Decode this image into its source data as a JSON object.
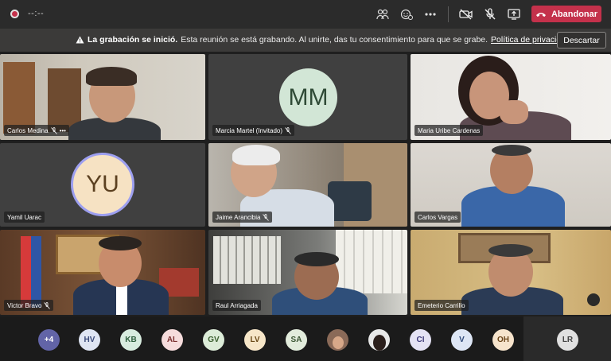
{
  "topbar": {
    "timer": "--:--",
    "leave_label": "Abandonar",
    "icons": [
      "people-icon",
      "react-icon",
      "more-icon",
      "camera-off-icon",
      "mic-off-icon",
      "share-screen-icon",
      "phone-hangup-icon"
    ]
  },
  "banner": {
    "title": "La grabación se inició.",
    "message": "Esta reunión se está grabando. Al unirte, das tu consentimiento para que se grabe.",
    "link": "Política de privacidad",
    "dismiss_label": "Descartar"
  },
  "participants": [
    {
      "name": "Carlos Medina",
      "more": "•••"
    },
    {
      "name": "Marcia Martel (Invitado)",
      "initials": "MM"
    },
    {
      "name": "Maria Uribe Cardenas"
    },
    {
      "name": "Yamil Uarac",
      "initials": "YU"
    },
    {
      "name": "Jaime Arancibia"
    },
    {
      "name": "Carlos Vargas"
    },
    {
      "name": "Victor Bravo"
    },
    {
      "name": "Raul Arriagada"
    },
    {
      "name": "Emeterio Carrillo"
    }
  ],
  "roster": {
    "overflow": "+4",
    "chips": [
      "HV",
      "KB",
      "AL",
      "GV",
      "LV",
      "SA",
      "",
      "",
      "CI",
      "V",
      "OH"
    ],
    "self": "LR"
  },
  "colors": {
    "leave": "#c4314b",
    "overflow_chip": "#6264a7",
    "avatar_mm": "#d2e6d6",
    "avatar_yu": "#f6e2c3"
  }
}
